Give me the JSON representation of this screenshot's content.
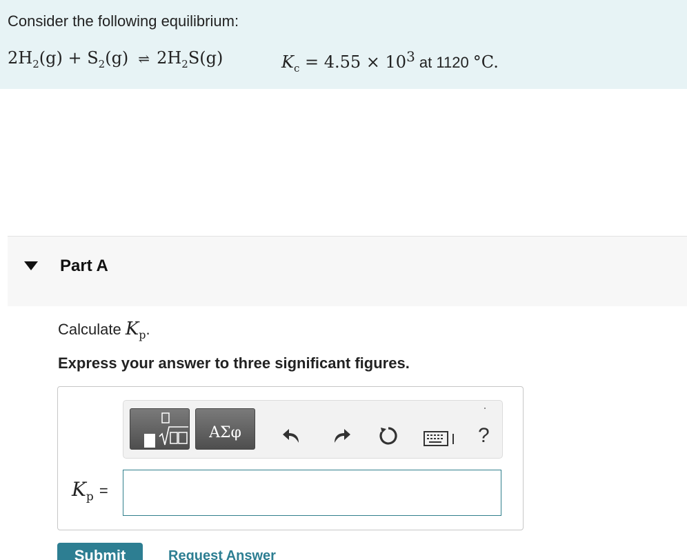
{
  "problem": {
    "intro": "Consider the following equilibrium:",
    "equation": {
      "coef_h2": "2H",
      "sub_h2": "2",
      "phase1": "(g) + S",
      "sub_s2": "2",
      "phase2": "(g)",
      "arrow": "⇌",
      "product": "2H",
      "sub_product": "2",
      "product_rest": "S(g)"
    },
    "constant": {
      "symbol": "K",
      "symbol_sub": "c",
      "relation": " = 4.55 × 10",
      "exponent": "3",
      "at_text": " at 1120 ",
      "unit": "°C."
    }
  },
  "part": {
    "title": "Part A",
    "prompt_text": "Calculate ",
    "prompt_symbol": "K",
    "prompt_sub": "p",
    "prompt_end": ".",
    "instruction": "Express your answer to three significant figures."
  },
  "toolbar": {
    "greek_label": "ΑΣφ",
    "help_label": "?"
  },
  "answer": {
    "label_symbol": "K",
    "label_sub": "p",
    "label_eq": "=",
    "value": ""
  },
  "actions": {
    "submit": "Submit",
    "request": "Request Answer"
  },
  "colors": {
    "intro_bg": "#e7f3f5",
    "accent": "#2d7e92"
  }
}
